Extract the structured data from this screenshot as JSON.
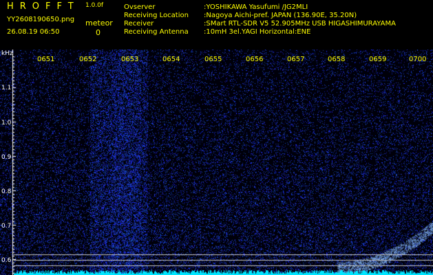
{
  "header": {
    "brand": "HROFFT",
    "version": "1.0.0f",
    "filename": "YY2608190650.png",
    "datetime": "26.08.19 06:50",
    "meteor_label": "meteor",
    "meteor_count": "0",
    "observer_label": "Ovserver",
    "observer_value": ":YOSHIKAWA Yasufumi /JG2MLI",
    "location_label": "Receiving Location",
    "location_value": ":Nagoya Aichi-pref. JAPAN (136.90E, 35.20N)",
    "receiver_label": "Receiver",
    "receiver_value": ":SMart RTL-SDR V5 52.905MHz USB HIGASHIMURAYAMA",
    "antenna_label": "Receiving Antenna",
    "antenna_value": ":10mH 3el.YAGI Horizontal:ENE"
  },
  "axis": {
    "unit": "kHz",
    "y_ticks": [
      "1.1",
      "1.0",
      "0.9",
      "0.8",
      "0.7",
      "0.6"
    ],
    "x_ticks": [
      "0651",
      "0652",
      "0653",
      "0654",
      "0655",
      "0656",
      "0657",
      "0658",
      "0659",
      "0700"
    ]
  },
  "colors": {
    "text": "#ffff00",
    "axis": "#ffffff",
    "background": "#000000",
    "noise": "#1a2acc",
    "baseline": "#00e5ff"
  }
}
